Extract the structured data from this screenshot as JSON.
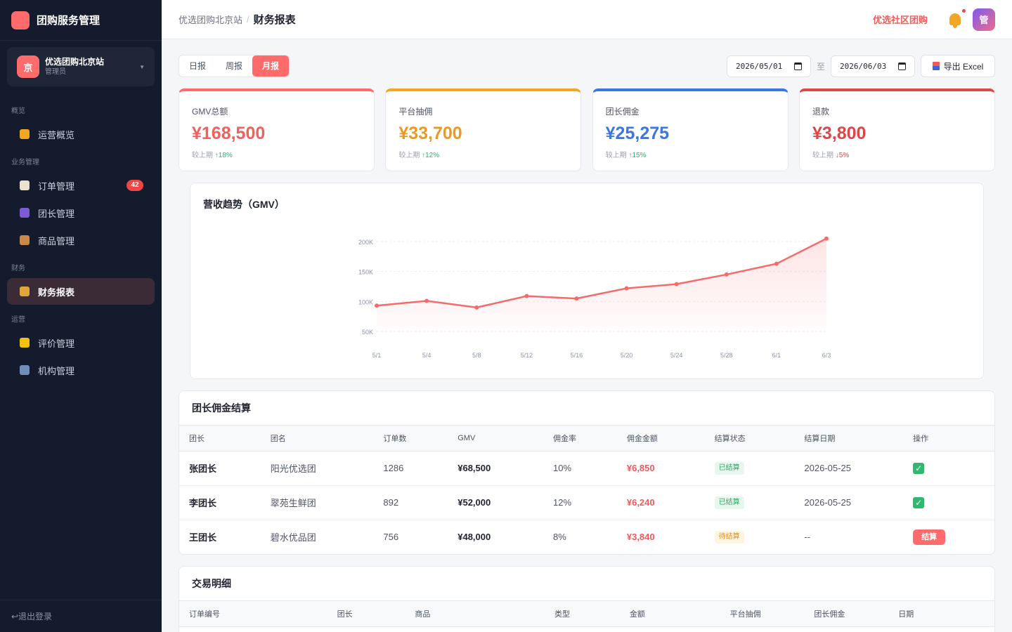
{
  "sidebar": {
    "brand": "团购服务管理",
    "org": {
      "avatar": "京",
      "name": "优选团购北京站",
      "role": "管理员"
    },
    "sections": [
      {
        "label": "概览",
        "items": [
          {
            "label": "运营概览",
            "icon": "chart-icon",
            "color": "#f2a623"
          }
        ]
      },
      {
        "label": "业务管理",
        "items": [
          {
            "label": "订单管理",
            "icon": "clipboard-icon",
            "color": "#e9e2cf",
            "badge": "42"
          },
          {
            "label": "团长管理",
            "icon": "users-icon",
            "color": "#7b5cd6"
          },
          {
            "label": "商品管理",
            "icon": "package-icon",
            "color": "#c8894a"
          }
        ]
      },
      {
        "label": "财务",
        "items": [
          {
            "label": "财务报表",
            "icon": "money-bag-icon",
            "color": "#e0a63a",
            "active": true
          }
        ]
      },
      {
        "label": "运营",
        "items": [
          {
            "label": "评价管理",
            "icon": "star-icon",
            "color": "#f4c20d"
          },
          {
            "label": "机构管理",
            "icon": "building-icon",
            "color": "#6f8fb8"
          }
        ]
      }
    ],
    "logout": "↩退出登录"
  },
  "header": {
    "breadcrumb_root": "优选团购北京站",
    "breadcrumb_sep": "/",
    "breadcrumb_current": "财务报表",
    "community_link": "优选社区团购",
    "user_avatar": "管"
  },
  "toolbar": {
    "periods": [
      {
        "label": "日报"
      },
      {
        "label": "周报"
      },
      {
        "label": "月报",
        "active": true
      }
    ],
    "date_from": "2026/05/01",
    "date_sep": "至",
    "date_to": "2026/06/03",
    "export_label": "导出 Excel"
  },
  "stats": [
    {
      "label": "GMV总额",
      "value": "¥168,500",
      "compare_label": "较上期",
      "change": "↑18%",
      "direction": "up",
      "color": "#f25f5c",
      "bar": "#ff6b6b"
    },
    {
      "label": "平台抽佣",
      "value": "¥33,700",
      "compare_label": "较上期",
      "change": "↑12%",
      "direction": "up",
      "color": "#f0971d",
      "bar": "#f2a623"
    },
    {
      "label": "团长佣金",
      "value": "¥25,275",
      "compare_label": "较上期",
      "change": "↑15%",
      "direction": "up",
      "color": "#3a76e4",
      "bar": "#3a76e4"
    },
    {
      "label": "退款",
      "value": "¥3,800",
      "compare_label": "较上期",
      "change": "↓5%",
      "direction": "down",
      "color": "#e04646",
      "bar": "#e04646"
    }
  ],
  "chart": {
    "title": "营收趋势（GMV）",
    "line_color": "#f56b6b"
  },
  "chart_data": {
    "type": "line",
    "title": "营收趋势（GMV）",
    "x": [
      "5/1",
      "5/4",
      "5/8",
      "5/12",
      "5/16",
      "5/20",
      "5/24",
      "5/28",
      "6/1",
      "6/3"
    ],
    "series": [
      {
        "values": [
          93000,
          101000,
          90000,
          109000,
          105000,
          122000,
          129000,
          145000,
          163000,
          205000
        ]
      }
    ],
    "y_ticks": [
      "50K",
      "100K",
      "150K",
      "200K"
    ],
    "y_tick_values": [
      50000,
      100000,
      150000,
      200000
    ],
    "ylim": [
      50000,
      200000
    ],
    "grid": true,
    "legend": "none"
  },
  "commission": {
    "title": "团长佣金结算",
    "headers": [
      "团长",
      "团名",
      "订单数",
      "GMV",
      "佣金率",
      "佣金金额",
      "结算状态",
      "结算日期",
      "操作"
    ],
    "rows": [
      {
        "leader": "张团长",
        "group": "阳光优选团",
        "orders": "1286",
        "gmv": "¥68,500",
        "rate": "10%",
        "amount": "¥6,850",
        "status": "已结算",
        "date": "2026-05-25",
        "action": "check"
      },
      {
        "leader": "李团长",
        "group": "翠苑生鲜团",
        "orders": "892",
        "gmv": "¥52,000",
        "rate": "12%",
        "amount": "¥6,240",
        "status": "已结算",
        "date": "2026-05-25",
        "action": "check"
      },
      {
        "leader": "王团长",
        "group": "碧水优品团",
        "orders": "756",
        "gmv": "¥48,000",
        "rate": "8%",
        "amount": "¥3,840",
        "status": "待结算",
        "date": "--",
        "action": "settle",
        "action_label": "结算"
      }
    ]
  },
  "transactions": {
    "title": "交易明细",
    "headers": [
      "订单编号",
      "团长",
      "商品",
      "类型",
      "金额",
      "平台抽佣",
      "团长佣金",
      "日期"
    ]
  }
}
